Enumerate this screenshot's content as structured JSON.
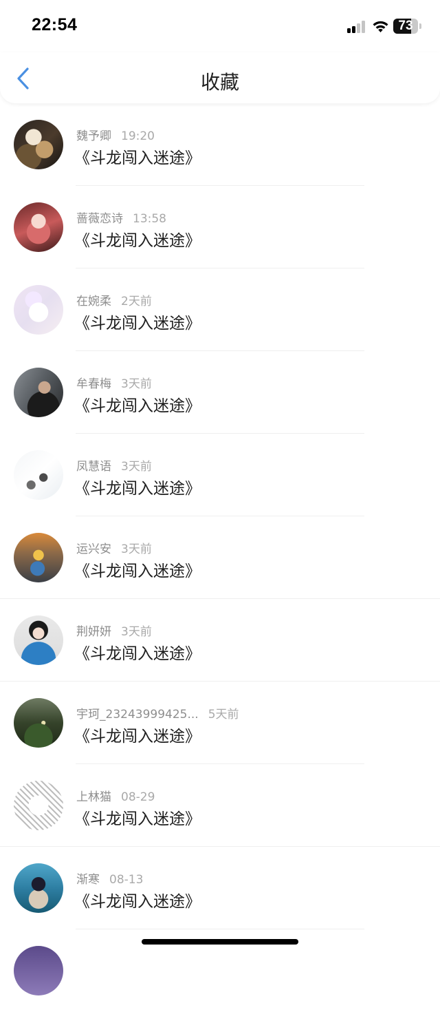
{
  "status_bar": {
    "time": "22:54",
    "battery": "73",
    "battery_level": 0.73
  },
  "nav": {
    "title": "收藏",
    "back_icon": "chevron-left-icon",
    "accent": "#4a90e2"
  },
  "list": [
    {
      "name": "魏予卿",
      "time": "19:20",
      "book": "《斗龙闯入迷途》",
      "avatar": "portrait-avatar-dark"
    },
    {
      "name": "蔷薇恋诗",
      "time": "13:58",
      "book": "《斗龙闯入迷途》",
      "avatar": "anime-girl-avatar"
    },
    {
      "name": "在婉柔",
      "time": "2天前",
      "book": "《斗龙闯入迷途》",
      "avatar": "bunny-avatar"
    },
    {
      "name": "牟春梅",
      "time": "3天前",
      "book": "《斗龙闯入迷途》",
      "avatar": "man-avatar"
    },
    {
      "name": "凤慧语",
      "time": "3天前",
      "book": "《斗龙闯入迷途》",
      "avatar": "cartoon-avatar"
    },
    {
      "name": "运兴安",
      "time": "3天前",
      "book": "《斗龙闯入迷途》",
      "avatar": "street-avatar"
    },
    {
      "name": "荆妍妍",
      "time": "3天前",
      "book": "《斗龙闯入迷途》",
      "avatar": "girl-avatar"
    },
    {
      "name": "宇珂_23243999425...",
      "time": "5天前",
      "book": "《斗龙闯入迷途》",
      "avatar": "garden-avatar"
    },
    {
      "name": "上林猫",
      "time": "08-29",
      "book": "《斗龙闯入迷途》",
      "avatar": "manga-avatar"
    },
    {
      "name": "渐寒",
      "time": "08-13",
      "book": "《斗龙闯入迷途》",
      "avatar": "ocean-girl-avatar"
    }
  ]
}
